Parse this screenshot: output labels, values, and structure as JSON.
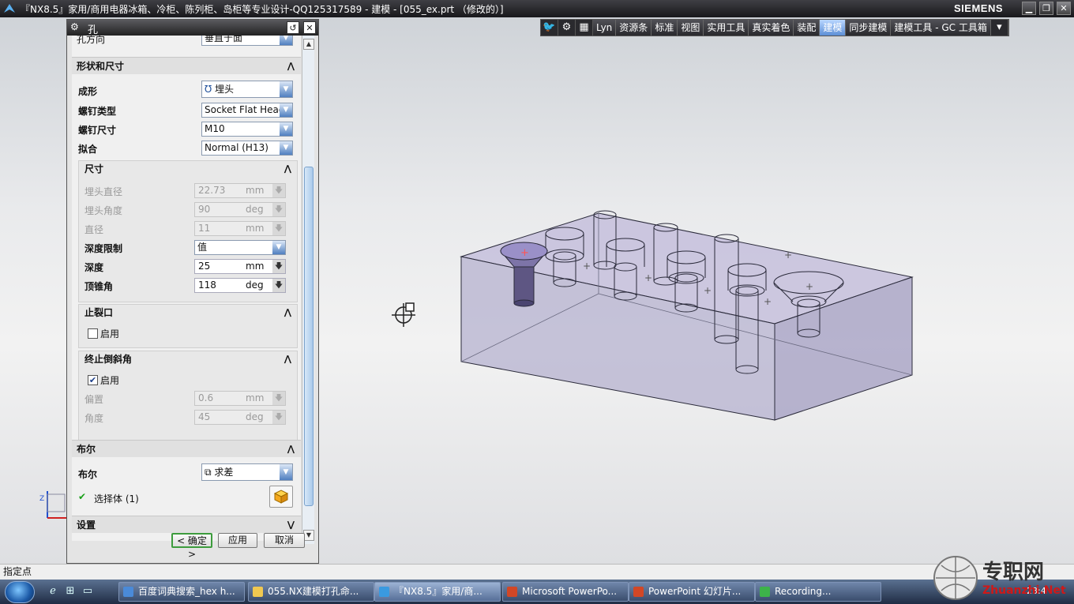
{
  "window": {
    "title": "『NX8.5』家用/商用电器冰箱、冷柜、陈列柜、岛柜等专业设计-QQ125317589 - 建模 - [055_ex.prt （修改的）]",
    "brand": "SIEMENS",
    "min_glyph": "▁",
    "max_glyph": "❐",
    "close_glyph": "✕"
  },
  "toolbar": {
    "tabs": [
      "Lyn",
      "资源条",
      "标准",
      "视图",
      "实用工具",
      "真实着色",
      "装配",
      "建模",
      "同步建模",
      "建模工具 - GC 工具箱"
    ],
    "active_tab": "建模",
    "more_glyph": "▾"
  },
  "dialog": {
    "title": "孔",
    "partial_row_label": "孔方向",
    "partial_row_value": "垂直于面",
    "shape_section": {
      "title": "形状和尺寸",
      "form_label": "成形",
      "form_value": "埋头",
      "screw_type_label": "螺钉类型",
      "screw_type_value": "Socket Flat Head",
      "screw_size_label": "螺钉尺寸",
      "screw_size_value": "M10",
      "fit_label": "拟合",
      "fit_value": "Normal (H13)"
    },
    "dimensions": {
      "title": "尺寸",
      "csk_diameter_label": "埋头直径",
      "csk_diameter_value": "22.73",
      "csk_angle_label": "埋头角度",
      "csk_angle_value": "90",
      "diameter_label": "直径",
      "diameter_value": "11",
      "depth_limit_label": "深度限制",
      "depth_limit_value": "值",
      "depth_label": "深度",
      "depth_value": "25",
      "tip_angle_label": "顶锥角",
      "tip_angle_value": "118"
    },
    "units": {
      "mm": "mm",
      "deg": "deg"
    },
    "relief": {
      "title": "止裂口",
      "enable_label": "启用",
      "enabled": false
    },
    "end_chamfer": {
      "title": "终止倒斜角",
      "enable_label": "启用",
      "enabled": true,
      "offset_label": "偏置",
      "offset_value": "0.6",
      "angle_label": "角度",
      "angle_value": "45"
    },
    "boolean": {
      "title": "布尔",
      "label": "布尔",
      "value": "求差",
      "select_body_label": "选择体 (1)"
    },
    "partial_section_title": "设置",
    "buttons": {
      "ok": "< 确定 >",
      "apply": "应用",
      "cancel": "取消"
    }
  },
  "status": {
    "prompt": "指定点"
  },
  "taskbar": {
    "items": [
      {
        "label": "百度词典搜索_hex h...",
        "active": false
      },
      {
        "label": "055.NX建模打孔命...",
        "active": false
      },
      {
        "label": "『NX8.5』家用/商...",
        "active": true
      },
      {
        "label": "Microsoft PowerPo...",
        "active": false
      },
      {
        "label": "PowerPoint 幻灯片...",
        "active": false
      },
      {
        "label": "Recording...",
        "active": false
      }
    ],
    "clock": "23:4"
  },
  "watermark": {
    "text": "专职网",
    "url": "Zhuanzhi.Net"
  },
  "colors": {
    "accent_blue": "#5d8fd6",
    "ok_border": "#3d9c3d",
    "solid_face": "#b6b1cf",
    "solid_edge": "#2a2a3a"
  }
}
